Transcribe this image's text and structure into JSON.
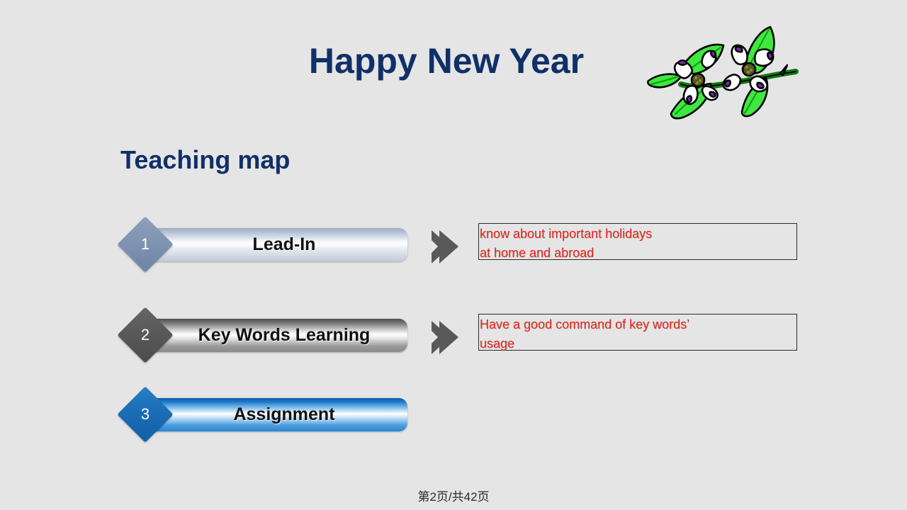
{
  "slide": {
    "title": "Happy New Year",
    "subtitle": "Teaching map",
    "footer": "第2页/共42页",
    "background_color": "#e5e5e5",
    "title_color": "#113068",
    "callout_text_color": "#e5251f"
  },
  "decoration": {
    "clipart_name": "dogwood-flower-branch",
    "leaf_color": "#3ee83e",
    "petal_color": "#ffffff",
    "petal_notch_color": "#7b2aa8",
    "flower_center_color": "#55561f",
    "stem_color": "#1f9e1f"
  },
  "rows": [
    {
      "number": "1",
      "label": "Lead-In",
      "diamond_color": "#7e92b1",
      "bar_style": "steel-blue",
      "callout": "know about important holidays\nat home and abroad"
    },
    {
      "number": "2",
      "label": "Key Words Learning",
      "diamond_color": "#585858",
      "bar_style": "silver",
      "callout": "Have a good command of key words’\nusage"
    },
    {
      "number": "3",
      "label": "Assignment",
      "diamond_color": "#1a6cb4",
      "bar_style": "blue",
      "callout": ""
    }
  ]
}
